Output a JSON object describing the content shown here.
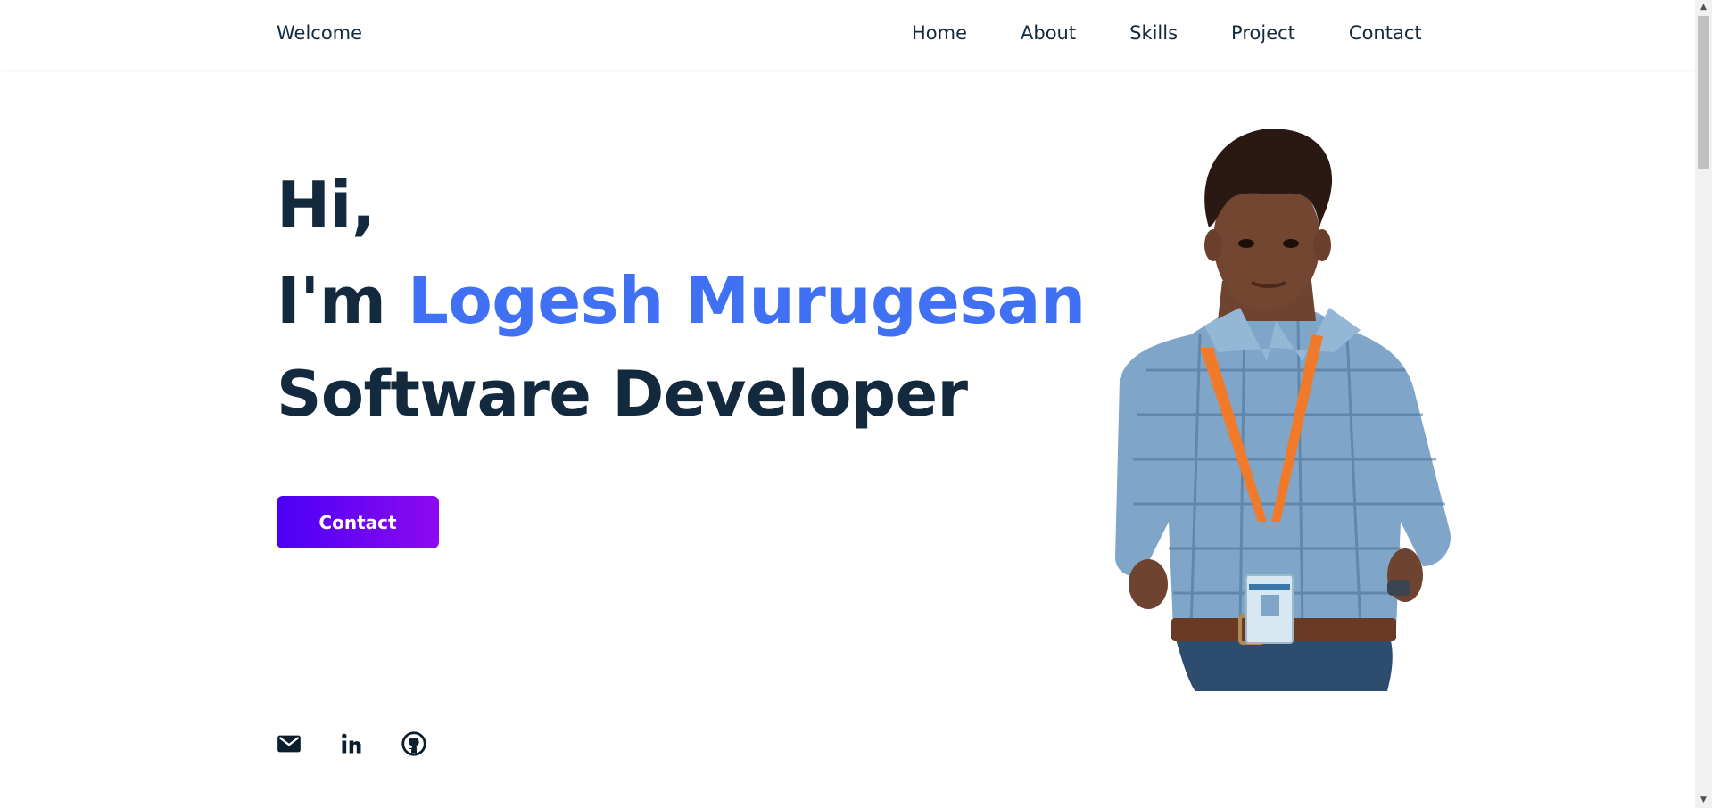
{
  "header": {
    "brand": "Welcome",
    "nav": [
      "Home",
      "About",
      "Skills",
      "Project",
      "Contact"
    ]
  },
  "hero": {
    "greeting": "Hi,",
    "intro_prefix": "I'm",
    "name": "Logesh Murugesan",
    "role": "Software Developer",
    "cta_label": "Contact"
  },
  "socials": [
    "mail-icon",
    "linkedin-icon",
    "github-icon"
  ],
  "colors": {
    "text": "#13293d",
    "accent": "#4070f4",
    "button_gradient_start": "#4b00f5",
    "button_gradient_end": "#8d0af0"
  }
}
